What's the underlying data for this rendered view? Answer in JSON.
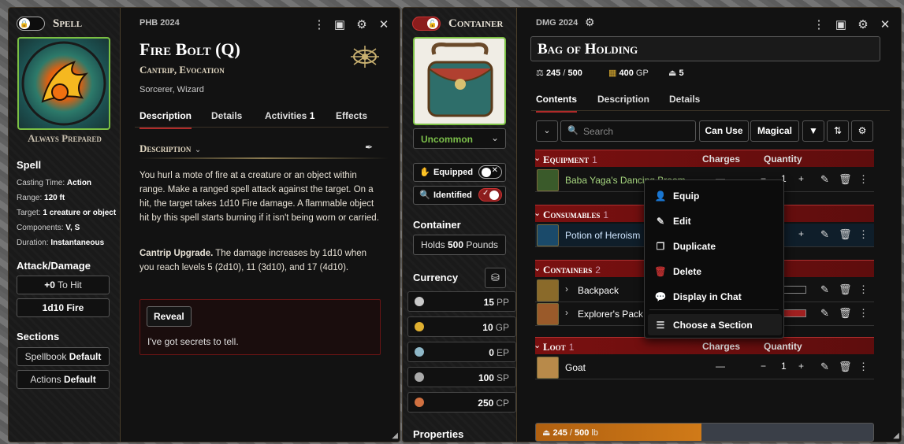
{
  "spell": {
    "sheet_label": "Spell",
    "source": "PHB 2024",
    "title": "Fire Bolt (Q)",
    "subtitle": "Cantrip, Evocation",
    "classes": "Sorcerer, Wizard",
    "prepared": "Always Prepared",
    "tabs": [
      {
        "label": "Description"
      },
      {
        "label": "Details"
      },
      {
        "label": "Activities",
        "count": "1"
      },
      {
        "label": "Effects"
      }
    ],
    "desc_heading": "Description",
    "desc_p1": "You hurl a mote of fire at a creature or an object within range. Make a ranged spell attack against the target. On a hit, the target takes 1d10 Fire damage. A flammable object hit by this spell starts burning if it isn't being worn or carried.",
    "desc_p2_bold": "Cantrip Upgrade.",
    "desc_p2": " The damage increases by 1d10 when you reach levels 5 (2d10), 11 (3d10), and 17 (4d10).",
    "reveal_label": "Reveal",
    "secret": "I've got secrets to tell.",
    "side_heading": "Spell",
    "props": [
      {
        "k": "Casting Time: ",
        "v": "Action"
      },
      {
        "k": "Range: ",
        "v": "120 ft"
      },
      {
        "k": "Target: ",
        "v": "1 creature or object"
      },
      {
        "k": "Components: ",
        "v": "V, S"
      },
      {
        "k": "Duration: ",
        "v": "Instantaneous"
      }
    ],
    "attack_heading": "Attack/Damage",
    "to_hit_value": "+0",
    "to_hit_label": "To Hit",
    "damage": "1d10 Fire",
    "sections_heading": "Sections",
    "spellbook_label": "Spellbook",
    "spellbook_value": "Default",
    "actions_label": "Actions",
    "actions_value": "Default"
  },
  "container": {
    "sheet_label": "Container",
    "source": "DMG 2024",
    "title": "Bag of Holding",
    "weight": "245",
    "weight_max": "500",
    "price": "400",
    "price_unit": "GP",
    "count": "5",
    "rarity": "Uncommon",
    "equipped_label": "Equipped",
    "identified_label": "Identified",
    "container_heading": "Container",
    "holds_prefix": "Holds",
    "holds_value": "500",
    "holds_unit": "Pounds",
    "currency_heading": "Currency",
    "currency": [
      {
        "v": "15",
        "u": "PP",
        "color": "#c9c9c9"
      },
      {
        "v": "10",
        "u": "GP",
        "color": "#e0b030"
      },
      {
        "v": "0",
        "u": "EP",
        "color": "#8fb8c8"
      },
      {
        "v": "100",
        "u": "SP",
        "color": "#aaaaaa"
      },
      {
        "v": "250",
        "u": "CP",
        "color": "#d07040"
      }
    ],
    "properties_heading": "Properties",
    "tabs": [
      {
        "label": "Contents"
      },
      {
        "label": "Description"
      },
      {
        "label": "Details"
      }
    ],
    "search_placeholder": "Search",
    "can_use": "Can Use",
    "magical": "Magical",
    "col_charges": "Charges",
    "col_quantity": "Quantity",
    "sections": [
      {
        "name": "Equipment",
        "count": "1"
      },
      {
        "name": "Consumables",
        "count": "1"
      },
      {
        "name": "Containers",
        "count": "2"
      },
      {
        "name": "Loot",
        "count": "1"
      }
    ],
    "items": [
      {
        "name": "Baba Yaga's Dancing Broom",
        "charges": "—",
        "qty": "1"
      },
      {
        "name": "Potion of Heroism",
        "charges": "",
        "qty": ""
      },
      {
        "name": "Backpack",
        "charges": "",
        "qty": ""
      },
      {
        "name": "Explorer's Pack",
        "charges": "",
        "qty": ""
      },
      {
        "name": "Goat",
        "charges": "—",
        "qty": "1"
      }
    ],
    "footer_weight": "245",
    "footer_max": "500",
    "footer_unit": "lb",
    "footer_fraction": 0.49,
    "menu": [
      {
        "label": "Equip",
        "icon": "user-icon"
      },
      {
        "label": "Edit",
        "icon": "pencil-icon"
      },
      {
        "label": "Duplicate",
        "icon": "copy-icon"
      },
      {
        "label": "Delete",
        "icon": "trash-icon"
      },
      {
        "label": "Display in Chat",
        "icon": "chat-icon"
      },
      {
        "label": "Choose a Section",
        "icon": "section-icon"
      }
    ],
    "colors": {
      "accent": "#b02a2a",
      "rarity": "#7cc04a",
      "section": "#7a1010"
    }
  }
}
